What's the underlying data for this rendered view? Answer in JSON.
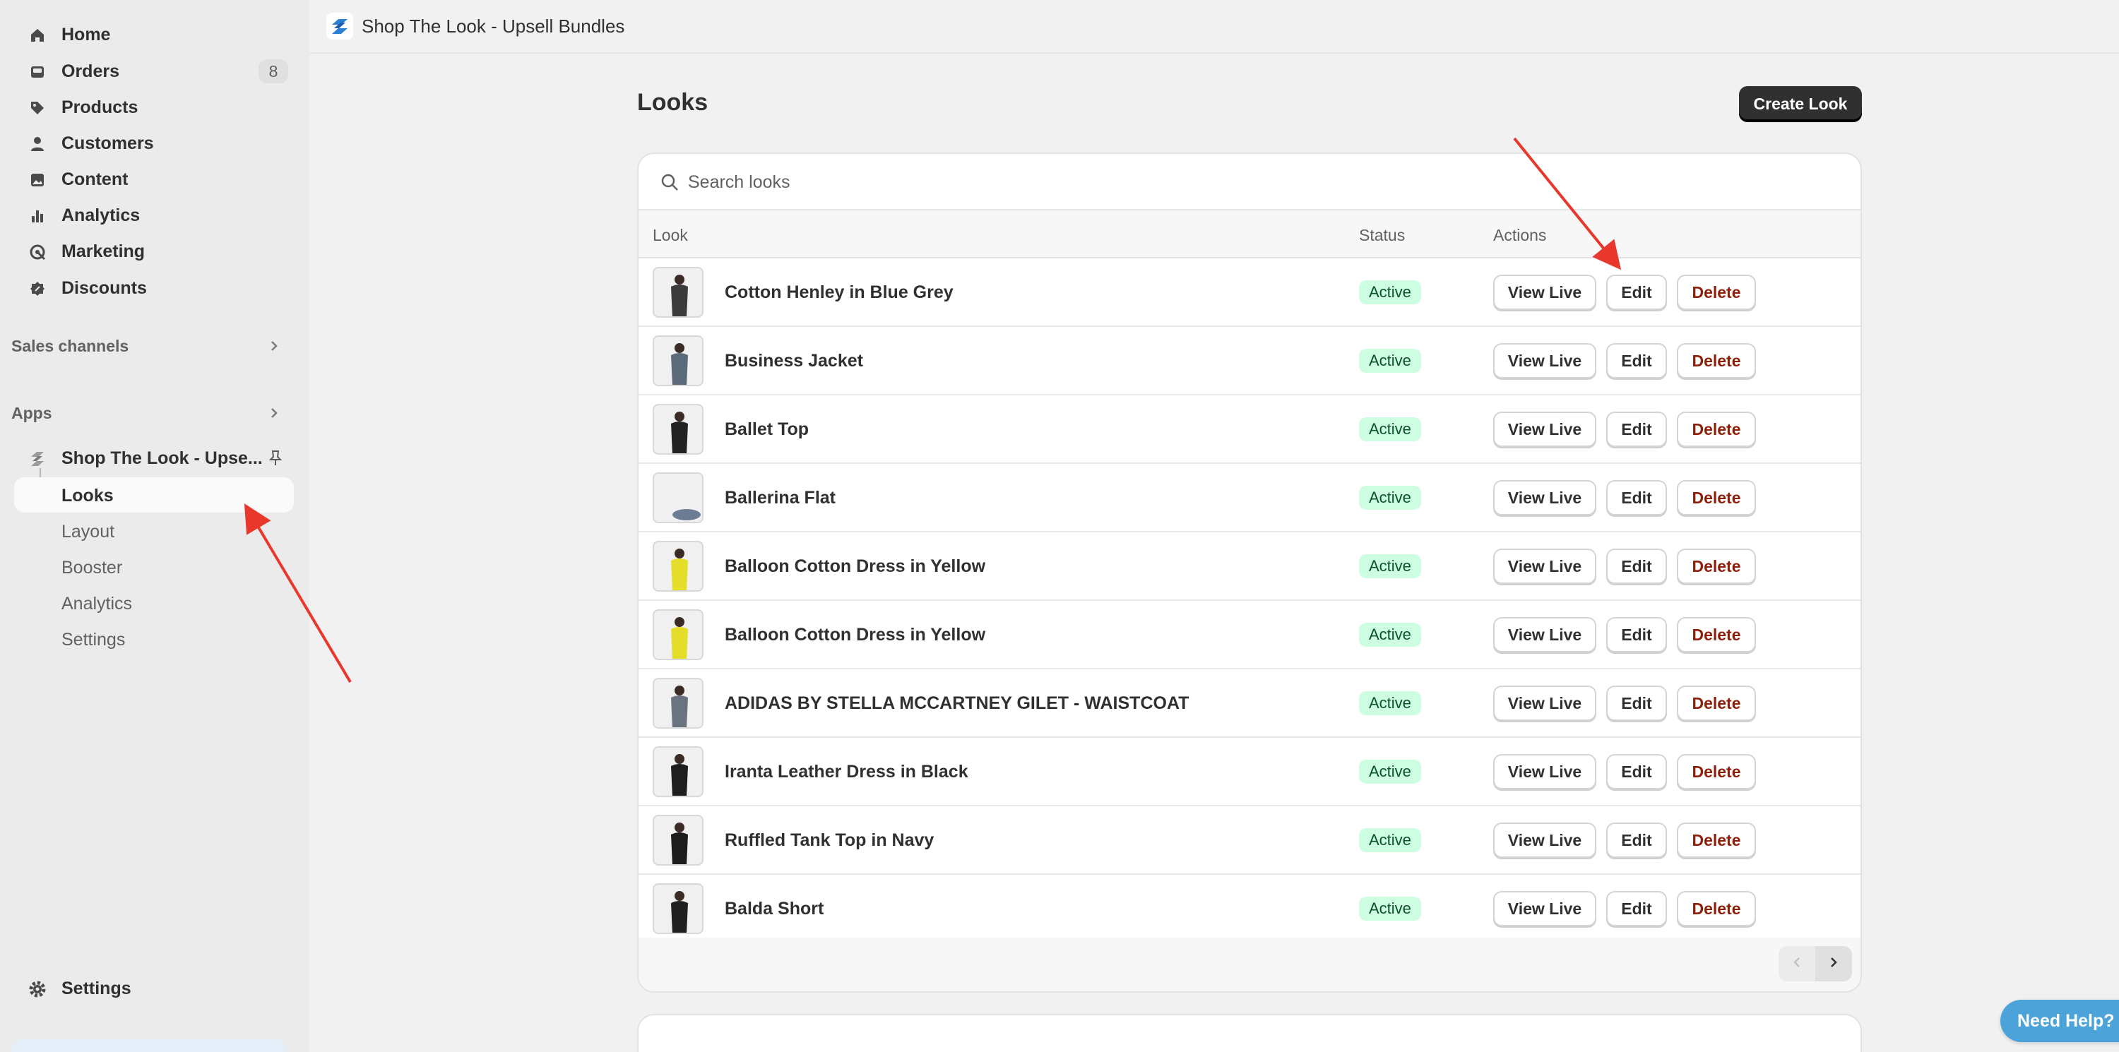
{
  "sidebar": {
    "nav": [
      {
        "label": "Home",
        "icon": "home-icon"
      },
      {
        "label": "Orders",
        "icon": "inbox-icon",
        "badge": "8"
      },
      {
        "label": "Products",
        "icon": "tag-icon"
      },
      {
        "label": "Customers",
        "icon": "person-icon"
      },
      {
        "label": "Content",
        "icon": "image-icon"
      },
      {
        "label": "Analytics",
        "icon": "bar-chart-icon"
      },
      {
        "label": "Marketing",
        "icon": "target-icon"
      },
      {
        "label": "Discounts",
        "icon": "discount-icon"
      }
    ],
    "sales_channels": "Sales channels",
    "apps": "Apps",
    "app_name": "Shop The Look - Upse...",
    "app_sub": [
      {
        "label": "Looks"
      },
      {
        "label": "Layout"
      },
      {
        "label": "Booster"
      },
      {
        "label": "Analytics"
      },
      {
        "label": "Settings"
      }
    ],
    "settings": "Settings"
  },
  "topbar": {
    "title": "Shop The Look - Upsell Bundles"
  },
  "page": {
    "title": "Looks",
    "create_label": "Create Look"
  },
  "search": {
    "placeholder": "Search looks"
  },
  "table": {
    "headers": {
      "look": "Look",
      "status": "Status",
      "actions": "Actions"
    },
    "actions": {
      "view": "View Live",
      "edit": "Edit",
      "delete": "Delete"
    },
    "rows": [
      {
        "name": "Cotton Henley in Blue Grey",
        "status": "Active"
      },
      {
        "name": "Business Jacket",
        "status": "Active"
      },
      {
        "name": "Ballet Top",
        "status": "Active"
      },
      {
        "name": "Ballerina Flat",
        "status": "Active"
      },
      {
        "name": "Balloon Cotton Dress in Yellow",
        "status": "Active"
      },
      {
        "name": "Balloon Cotton Dress in Yellow",
        "status": "Active"
      },
      {
        "name": "ADIDAS BY STELLA MCCARTNEY GILET - WAISTCOAT",
        "status": "Active"
      },
      {
        "name": "Iranta Leather Dress in Black",
        "status": "Active"
      },
      {
        "name": "Ruffled Tank Top in Navy",
        "status": "Active"
      },
      {
        "name": "Balda Short",
        "status": "Active"
      }
    ]
  },
  "help": {
    "label": "Need Help?"
  },
  "colors": {
    "accent": "#303030",
    "active_badge": "#cdfee1",
    "delete_text": "#8e1f0b",
    "annotation_arrow": "#e8372c",
    "help_button": "#4ba3d9"
  }
}
